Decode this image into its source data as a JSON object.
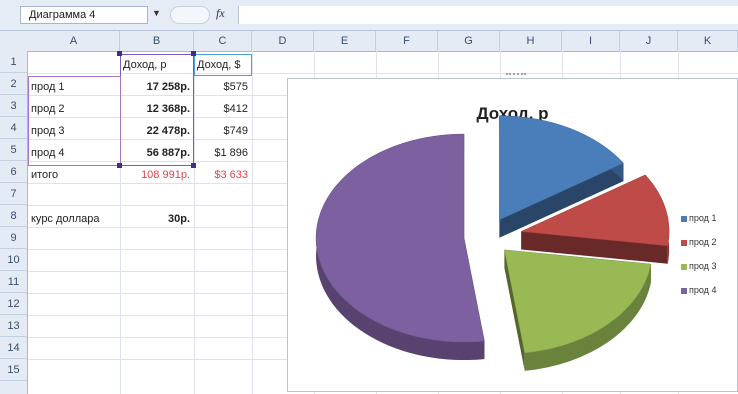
{
  "namebox": {
    "value": "Диаграмма 4"
  },
  "formula": {
    "fx": "fx"
  },
  "columns": [
    "A",
    "B",
    "C",
    "D",
    "E",
    "F",
    "G",
    "H",
    "I",
    "J",
    "K"
  ],
  "rows": [
    "1",
    "2",
    "3",
    "4",
    "5",
    "6",
    "7",
    "8",
    "9",
    "10",
    "11",
    "12",
    "13",
    "14",
    "15"
  ],
  "cells": {
    "B1": "Доход, р",
    "C1": "Доход, $",
    "A2": "прод 1",
    "B2": "17 258р.",
    "C2": "$575",
    "A3": "прод 2",
    "B3": "12 368р.",
    "C3": "$412",
    "A4": "прод 3",
    "B4": "22 478р.",
    "C4": "$749",
    "A5": "прод 4",
    "B5": "56 887р.",
    "C5": "$1 896",
    "A6": "итого",
    "B6": "108 991р.",
    "C6": "$3 633",
    "A8": "курс доллара",
    "B8": "30р."
  },
  "chart_data": {
    "type": "pie",
    "title": "Доход, р",
    "categories": [
      "прод 1",
      "прод 2",
      "прод 3",
      "прод 4"
    ],
    "values": [
      17258,
      12368,
      22478,
      56887
    ],
    "colors": [
      "#4a7ebb",
      "#be4b48",
      "#98b954",
      "#7d60a0"
    ],
    "exploded": true,
    "three_d": true,
    "legend_position": "right"
  },
  "colors": {
    "selection": "#7a5cc0",
    "total_red": "#e0464b"
  }
}
